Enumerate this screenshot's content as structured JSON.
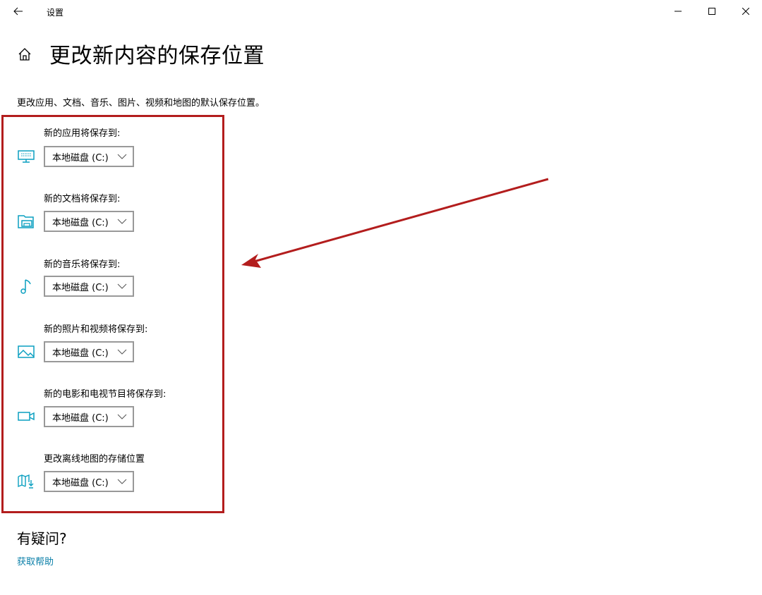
{
  "window": {
    "app_title": "设置",
    "accent_color": "#0a9fc0"
  },
  "page": {
    "title": "更改新内容的保存位置",
    "description": "更改应用、文档、音乐、图片、视频和地图的默认保存位置。"
  },
  "locations": [
    {
      "label": "新的应用将保存到:",
      "icon": "monitor-icon",
      "value": "本地磁盘 (C:)"
    },
    {
      "label": "新的文档将保存到:",
      "icon": "folder-icon",
      "value": "本地磁盘 (C:)"
    },
    {
      "label": "新的音乐将保存到:",
      "icon": "music-note-icon",
      "value": "本地磁盘 (C:)"
    },
    {
      "label": "新的照片和视频将保存到:",
      "icon": "picture-icon",
      "value": "本地磁盘 (C:)"
    },
    {
      "label": "新的电影和电视节目将保存到:",
      "icon": "video-camera-icon",
      "value": "本地磁盘 (C:)"
    },
    {
      "label": "更改离线地图的存储位置",
      "icon": "map-download-icon",
      "value": "本地磁盘 (C:)"
    }
  ],
  "help": {
    "title": "有疑问?",
    "link": "获取帮助"
  },
  "annotation": {
    "box_color": "#b31d1d"
  }
}
